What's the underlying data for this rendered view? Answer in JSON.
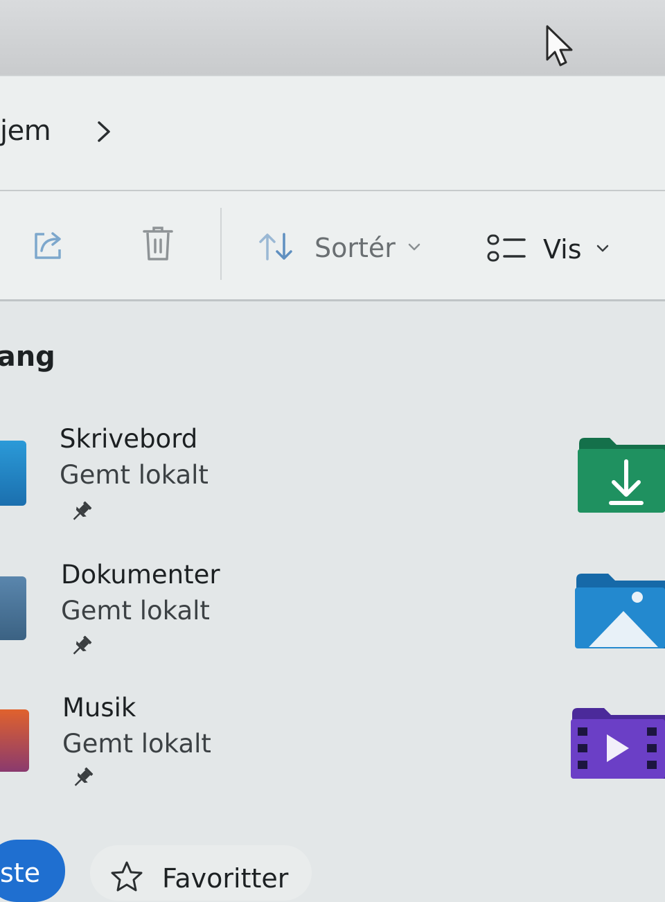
{
  "breadcrumb": {
    "current": "jem",
    "separator_icon": "chevron-right-icon"
  },
  "toolbar": {
    "share_icon": "share-icon",
    "delete_icon": "trash-icon",
    "sort_label": "Sortér",
    "view_label": "Vis"
  },
  "section": {
    "title": "jang"
  },
  "pinned_items": [
    {
      "title": "Skrivebord",
      "status": "Gemt lokalt",
      "icon": "desktop-folder-icon"
    },
    {
      "title": "Dokumenter",
      "status": "Gemt lokalt",
      "icon": "documents-folder-icon"
    },
    {
      "title": "Musik",
      "status": "Gemt lokalt",
      "icon": "music-folder-icon"
    }
  ],
  "side_folders": [
    {
      "icon": "downloads-folder-icon",
      "color": "#1e8a5a"
    },
    {
      "icon": "pictures-folder-icon",
      "color": "#1f86c8"
    },
    {
      "icon": "videos-folder-icon",
      "color": "#6a3bc0"
    }
  ],
  "bottom": {
    "home_label": "ste",
    "favorites_label": "Favoritter"
  },
  "colors": {
    "accent": "#1f6fd0",
    "background": "#e3e7e8"
  }
}
